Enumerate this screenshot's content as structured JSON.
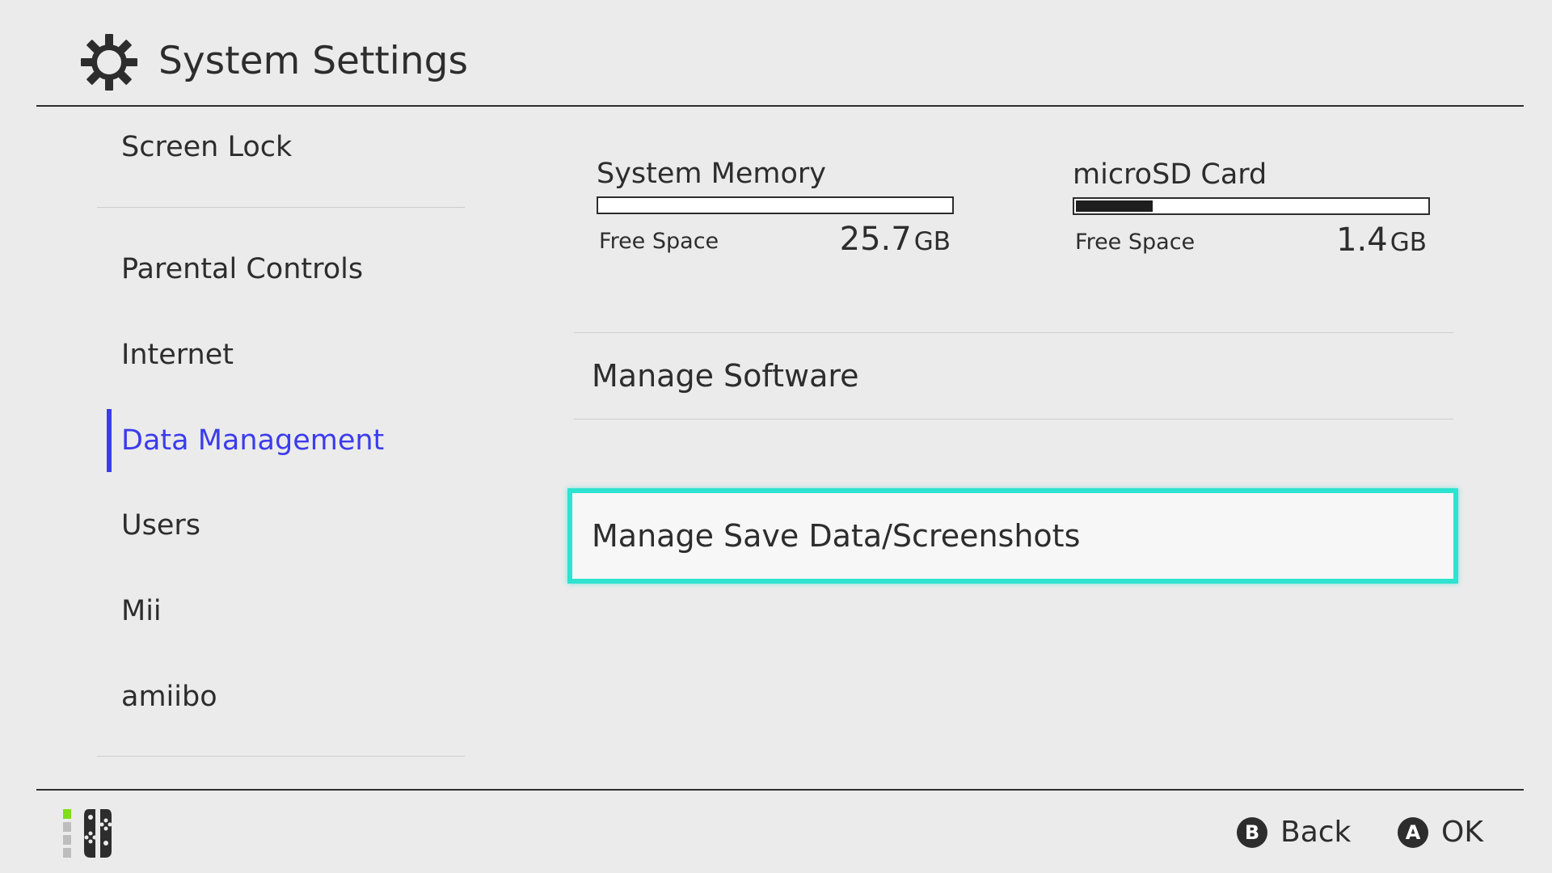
{
  "header": {
    "title": "System Settings",
    "icon": "gear-icon"
  },
  "sidebar": {
    "items": [
      {
        "label": "Screen Lock",
        "selected": false
      },
      {
        "label": "Parental Controls",
        "selected": false
      },
      {
        "label": "Internet",
        "selected": false
      },
      {
        "label": "Data Management",
        "selected": true
      },
      {
        "label": "Users",
        "selected": false
      },
      {
        "label": "Mii",
        "selected": false
      },
      {
        "label": "amiibo",
        "selected": false
      }
    ]
  },
  "storage": {
    "system_memory": {
      "name": "System Memory",
      "free_label": "Free Space",
      "free_value": "25.7",
      "free_unit": "GB",
      "used_fraction": 0.0
    },
    "microsd": {
      "name": "microSD Card",
      "free_label": "Free Space",
      "free_value": "1.4",
      "free_unit": "GB",
      "used_fraction": 0.22
    }
  },
  "content": {
    "manage_software": "Manage Software",
    "manage_save": "Manage Save Data/Screenshots"
  },
  "footer": {
    "back": {
      "glyph": "B",
      "label": "Back"
    },
    "ok": {
      "glyph": "A",
      "label": "OK"
    }
  },
  "colors": {
    "accent": "#3c3cec",
    "focus": "#2ee3cf",
    "background": "#ebebeb"
  }
}
